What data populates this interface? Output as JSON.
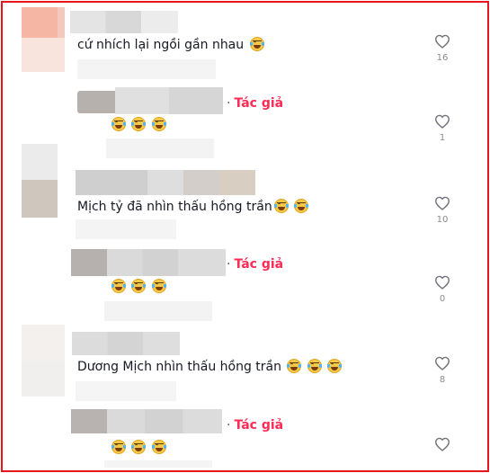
{
  "comments": [
    {
      "text": "cứ nhích lại ngồi gần nhau",
      "emoji_count": 1,
      "likes": "16"
    },
    {
      "author_tag": "Tác giả",
      "emoji_count": 3,
      "likes": "1"
    },
    {
      "text": "Mịch tỷ đã nhìn thấu hồng trần",
      "emoji_count": 2,
      "likes": "10"
    },
    {
      "author_tag": "Tác giả",
      "emoji_count": 3,
      "likes": "0"
    },
    {
      "text": "Dương Mịch nhìn thấu hồng trần",
      "emoji_count": 3,
      "likes": "8"
    },
    {
      "author_tag": "Tác giả",
      "emoji_count": 3,
      "likes": ""
    }
  ],
  "emoji_icon": "grinning-squinting-tears-emoji",
  "heart_icon": "heart-outline-icon",
  "colors": {
    "frame": "#e6161b",
    "author": "#fe2c55",
    "muted": "#8a8b91"
  }
}
